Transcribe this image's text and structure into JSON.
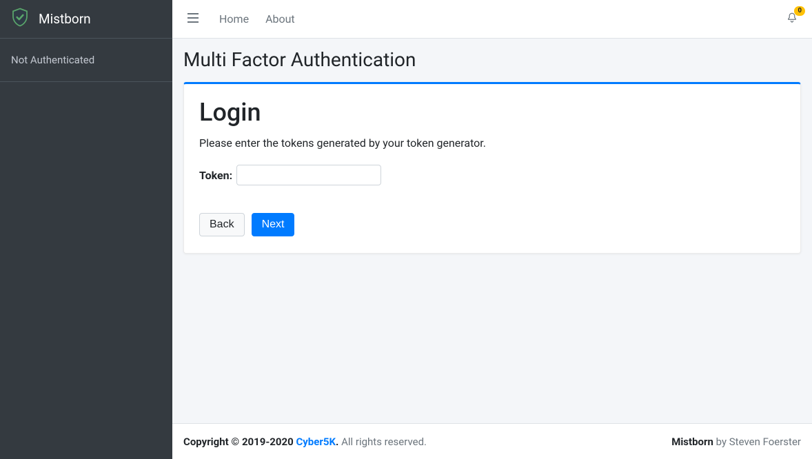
{
  "brand": {
    "name": "Mistborn"
  },
  "sidebar": {
    "status": "Not Authenticated"
  },
  "topbar": {
    "links": [
      "Home",
      "About"
    ],
    "notifications_count": "0"
  },
  "page": {
    "title": "Multi Factor Authentication"
  },
  "card": {
    "heading": "Login",
    "subtext": "Please enter the tokens generated by your token generator.",
    "token_label": "Token:",
    "token_value": "",
    "back_label": "Back",
    "next_label": "Next"
  },
  "footer": {
    "copyright_strong": "Copyright © 2019-2020 ",
    "company": "Cyber5K",
    "period": ".",
    "rights": " All rights reserved.",
    "product_strong": "Mistborn",
    "by": " by Steven Foerster"
  }
}
